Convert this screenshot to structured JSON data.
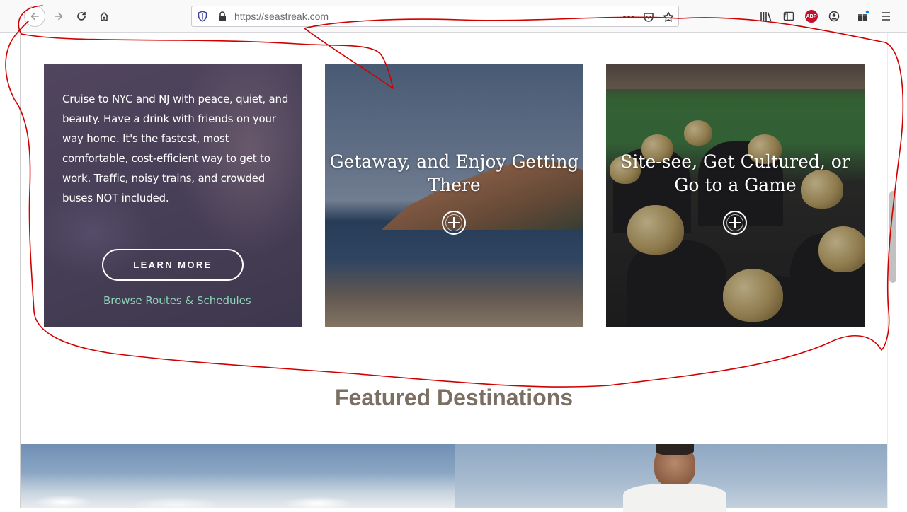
{
  "browser": {
    "url": "https://seastreak.com"
  },
  "cards": [
    {
      "description": "Cruise to NYC and NJ with peace, quiet, and beauty. Have a drink with friends on your way home. It's the fastest, most comfortable, cost-efficient way to get to work. Traffic, noisy trains, and crowded buses NOT included.",
      "button_label": "LEARN MORE",
      "link_text": "Browse Routes & Schedules"
    },
    {
      "title": "Getaway, and Enjoy Getting There"
    },
    {
      "title": "Site-see, Get Cultured, or Go to a Game"
    }
  ],
  "section": {
    "heading": "Featured Destinations"
  },
  "colors": {
    "link": "#8fd3b8",
    "heading": "#7a6f62",
    "annotation": "#d10000"
  }
}
